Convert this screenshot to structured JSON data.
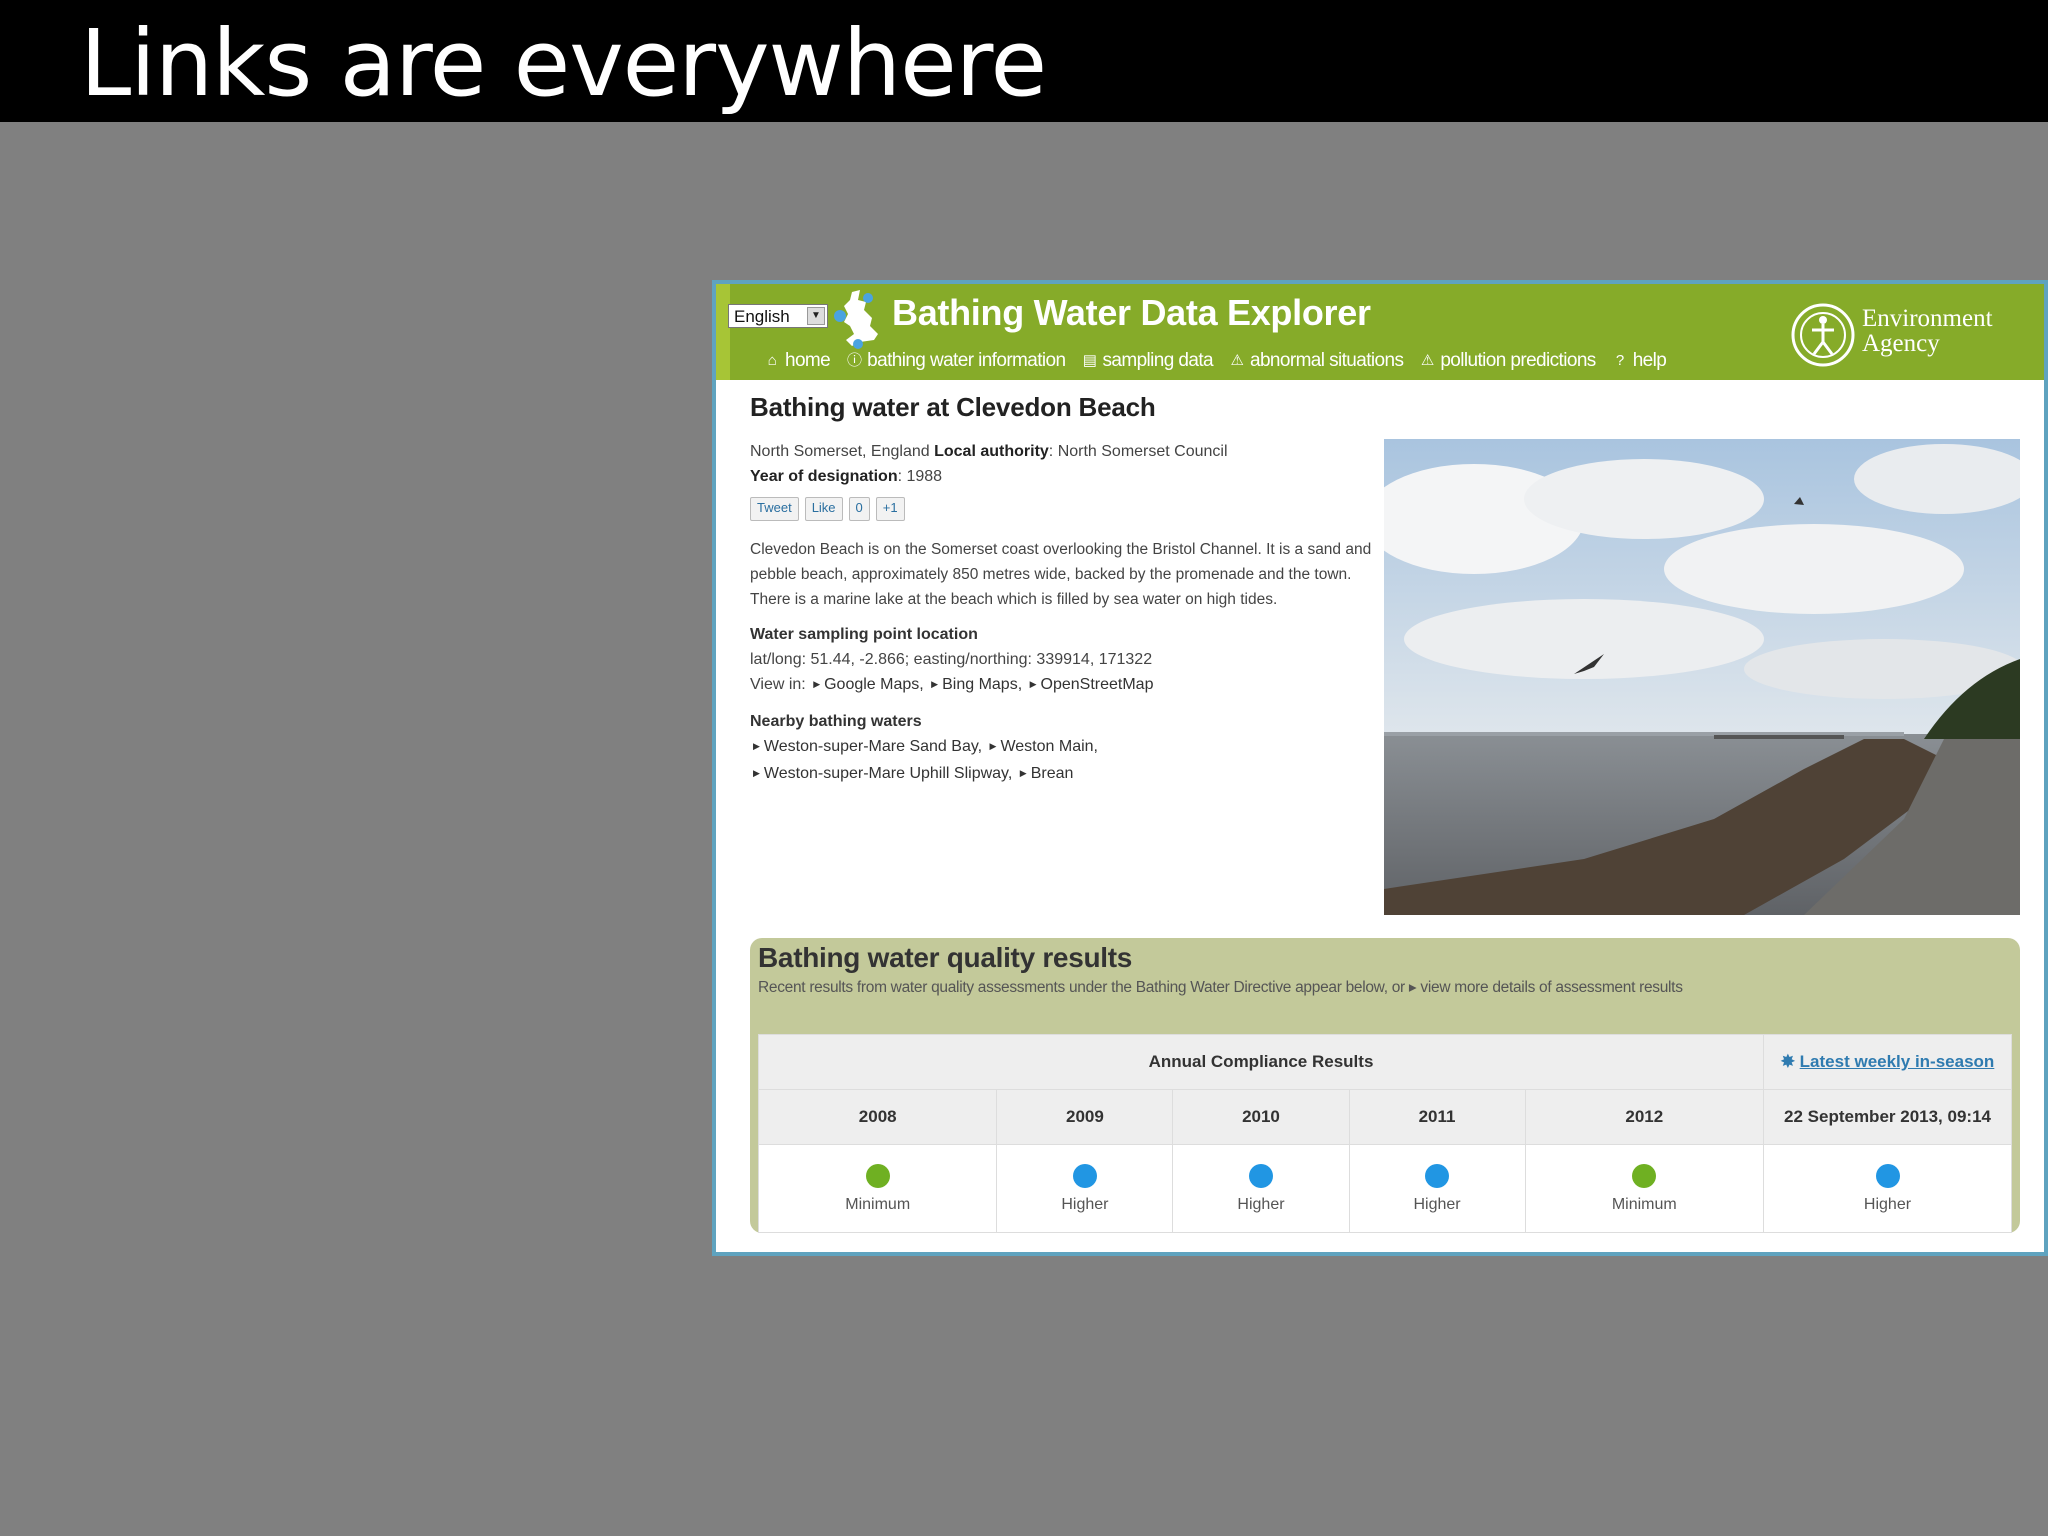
{
  "slide": {
    "title": "Links are everywhere"
  },
  "header": {
    "language": "English",
    "app_title": "Bathing Water Data Explorer",
    "logo_text_line1": "Environment",
    "logo_text_line2": "Agency",
    "nav": [
      {
        "label": "home",
        "icon": "home-icon",
        "glyph": "⌂"
      },
      {
        "label": "bathing water information",
        "icon": "info-icon",
        "glyph": "ⓘ"
      },
      {
        "label": "sampling data",
        "icon": "chart-icon",
        "glyph": "▤"
      },
      {
        "label": "abnormal situations",
        "icon": "warning-icon",
        "glyph": "⚠"
      },
      {
        "label": "pollution predictions",
        "icon": "warning-icon",
        "glyph": "⚠"
      },
      {
        "label": "help",
        "icon": "help-icon",
        "glyph": "?"
      }
    ]
  },
  "page": {
    "heading": "Bathing water at Clevedon Beach",
    "location": "North Somerset, England",
    "local_authority_label": "Local authority",
    "local_authority": ": North Somerset Council",
    "designation_label": "Year of designation",
    "designation_year": ": 1988",
    "social": {
      "tweet": "Tweet",
      "like": "Like",
      "like_count": "0",
      "plus": "+1"
    },
    "description": "Clevedon Beach is on the Somerset coast overlooking the Bristol Channel. It is a sand and pebble beach, approximately 850 metres wide, backed by the promenade and the town. There is a marine lake at the beach which is filled by sea water on high tides.",
    "sampling_heading": "Water sampling point location",
    "latlong": "lat/long: 51.44, -2.866;  easting/northing: 339914, 171322",
    "view_in_label": "View in:",
    "map_links": [
      "Google Maps,",
      "Bing Maps,",
      "OpenStreetMap"
    ],
    "nearby_heading": "Nearby bathing waters",
    "nearby": [
      "Weston-super-Mare Sand Bay,",
      "Weston Main,",
      "Weston-super-Mare Uphill Slipway,",
      "Brean"
    ]
  },
  "results": {
    "heading": "Bathing water quality results",
    "subtext": "Recent results from water quality assessments under the Bathing Water Directive appear below, or ▸ view more details of assessment results",
    "annual_header": "Annual Compliance Results",
    "latest_link": "Latest weekly in-season",
    "latest_date": "22 September 2013, 09:14",
    "latest_result": {
      "label": "Higher",
      "color": "#2196e3"
    },
    "years": [
      {
        "year": "2008",
        "label": "Minimum",
        "color": "#6fb022"
      },
      {
        "year": "2009",
        "label": "Higher",
        "color": "#2196e3"
      },
      {
        "year": "2010",
        "label": "Higher",
        "color": "#2196e3"
      },
      {
        "year": "2011",
        "label": "Higher",
        "color": "#2196e3"
      },
      {
        "year": "2012",
        "label": "Minimum",
        "color": "#6fb022"
      }
    ]
  }
}
